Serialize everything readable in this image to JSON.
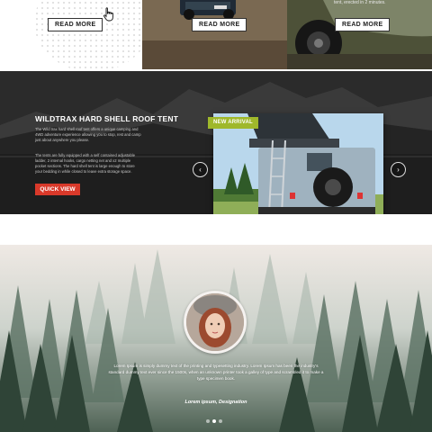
{
  "cards": [
    {
      "button": "READ MORE"
    },
    {
      "button": "READ MORE"
    },
    {
      "button": "READ MORE",
      "caption": "tent, erected in 2 minutes."
    }
  ],
  "slider": {
    "title": "WILDTRAX HARD SHELL ROOF TENT",
    "paragraph1": "The Wild trax hard shell roof tent offers a unique camping and 4WD adventure experience allowing you to stop, rest and camp just about anywhere you please.",
    "paragraph2": "The tents are fully equipped with a self contained adjustable ladder, 2 internal hooks, cargo netting net and x2 multiple pocket sections. The hard shell tent is large enough to store your bedding in while closed to leave extra storage space.",
    "cta": "QUICK VIEW",
    "badge": "NEW ARRIVAL",
    "prev": "‹",
    "next": "›"
  },
  "testimonial": {
    "quote": "Lorem Ipsum is simply dummy text of the printing and typesetting industry. Lorem Ipsum has been the industry's standard dummy text ever since the 1500s, when an unknown printer took a galley of type and scrambled it to make a type specimen book.",
    "author": "Lorem ipsum, Designation",
    "slide_count": 3,
    "active_slide": 2
  },
  "colors": {
    "accent_red": "#d9392a",
    "badge_green": "#9fb82b",
    "slider_bg": "#2a2a2a"
  },
  "icons": [
    "hand-pointer-icon",
    "chevron-left-icon",
    "chevron-right-icon"
  ]
}
